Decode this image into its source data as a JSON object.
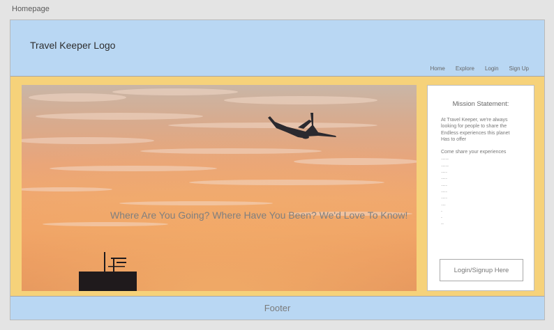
{
  "page": {
    "label": "Homepage"
  },
  "header": {
    "logo": "Travel Keeper Logo",
    "nav": [
      "Home",
      "Explore",
      "Login",
      "Sign Up"
    ]
  },
  "hero": {
    "tagline": "Where Are You Going? Where Have You Been? We'd Love To Know!"
  },
  "sidebar": {
    "title": "Mission Statement:",
    "body_lines": [
      "At Travel Keeper, we're always",
      "looking for people to share the",
      "Endless experiences this planet",
      "Has to offer"
    ],
    "cta_text": "Come share your experiences",
    "dot_lines": [
      "…..",
      "…..",
      "….",
      "….",
      "….",
      "….",
      "….",
      "…",
      ".",
      ".",
      ".."
    ],
    "button": "Login/Signup Here"
  },
  "footer": {
    "label": "Footer"
  },
  "colors": {
    "background": "#e4e4e4",
    "header": "#b9d7f3",
    "body": "#f6d27a",
    "panel": "#ffffff"
  },
  "icons": {
    "hero_image": "airplane-sunset-image"
  }
}
